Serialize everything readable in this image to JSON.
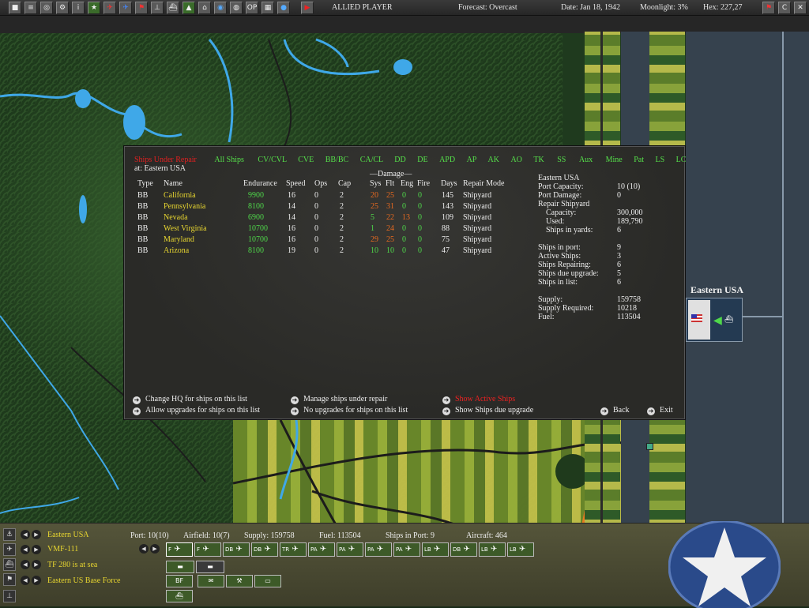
{
  "topbar": {
    "player": "ALLIED PLAYER",
    "forecast": "Forecast: Overcast",
    "date": "Date: Jan 18, 1942",
    "moonlight": "Moonlight: 3%",
    "hex": "Hex: 227,27",
    "icons": [
      "map-icon",
      "report-icon",
      "globe-icon",
      "settings-icon",
      "info-icon",
      "star-icon",
      "aircraft-icon",
      "plane-icon",
      "flag-icon",
      "unit-icon",
      "ship-icon",
      "base-icon",
      "factory-icon",
      "route-icon",
      "sphere-icon",
      "op-icon",
      "grid-icon",
      "help-icon",
      "end-turn-icon"
    ],
    "right_icons": [
      "flag-icon",
      "c-icon",
      "close-icon"
    ]
  },
  "map": {
    "location_label": "Eastern USA"
  },
  "dialog": {
    "categories": [
      "Ships Under Repair",
      "All Ships",
      "CV/CVL",
      "CVE",
      "BB/BC",
      "CA/CL",
      "DD",
      "DE",
      "APD",
      "AP",
      "AK",
      "AO",
      "TK",
      "SS",
      "Aux",
      "Mine",
      "Pat",
      "LS",
      "LC"
    ],
    "location": "at: Eastern USA",
    "damage_header": "—Damage—",
    "columns": [
      "Type",
      "Name",
      "Endurance",
      "Speed",
      "Ops",
      "Cap",
      "Sys",
      "Flt",
      "Eng",
      "Fire",
      "Days",
      "Repair Mode"
    ],
    "ships": [
      {
        "type": "BB",
        "name": "California",
        "endurance": "9900",
        "speed": "16",
        "ops": "0",
        "cap": "2",
        "sys": "20",
        "flt": "25",
        "eng": "0",
        "fire": "0",
        "days": "145",
        "mode": "Shipyard",
        "sys_color": "orange",
        "flt_color": "orange"
      },
      {
        "type": "BB",
        "name": "Pennsylvania",
        "endurance": "8100",
        "speed": "14",
        "ops": "0",
        "cap": "2",
        "sys": "25",
        "flt": "31",
        "eng": "0",
        "fire": "0",
        "days": "143",
        "mode": "Shipyard",
        "sys_color": "orange",
        "flt_color": "orange"
      },
      {
        "type": "BB",
        "name": "Nevada",
        "endurance": "6900",
        "speed": "14",
        "ops": "0",
        "cap": "2",
        "sys": "5",
        "flt": "22",
        "eng": "13",
        "fire": "0",
        "days": "109",
        "mode": "Shipyard",
        "sys_color": "green",
        "flt_color": "orange"
      },
      {
        "type": "BB",
        "name": "West Virginia",
        "endurance": "10700",
        "speed": "16",
        "ops": "0",
        "cap": "2",
        "sys": "1",
        "flt": "24",
        "eng": "0",
        "fire": "0",
        "days": "88",
        "mode": "Shipyard",
        "sys_color": "green",
        "flt_color": "orange"
      },
      {
        "type": "BB",
        "name": "Maryland",
        "endurance": "10700",
        "speed": "16",
        "ops": "0",
        "cap": "2",
        "sys": "29",
        "flt": "25",
        "eng": "0",
        "fire": "0",
        "days": "75",
        "mode": "Shipyard",
        "sys_color": "orange",
        "flt_color": "orange"
      },
      {
        "type": "BB",
        "name": "Arizona",
        "endurance": "8100",
        "speed": "19",
        "ops": "0",
        "cap": "2",
        "sys": "10",
        "flt": "10",
        "eng": "0",
        "fire": "0",
        "days": "47",
        "mode": "Shipyard",
        "sys_color": "green",
        "flt_color": "green"
      }
    ],
    "port_info": [
      {
        "label": "Eastern USA",
        "value": ""
      },
      {
        "label": "Port Capacity:",
        "value": "10 (10)"
      },
      {
        "label": "Port Damage:",
        "value": "0"
      },
      {
        "label": "Repair Shipyard",
        "value": ""
      },
      {
        "label": "Capacity:",
        "value": "300,000"
      },
      {
        "label": "Used:",
        "value": "189,790"
      },
      {
        "label": "Ships in yards:",
        "value": "6"
      },
      {
        "label": "",
        "value": ""
      },
      {
        "label": "Ships in port:",
        "value": "9"
      },
      {
        "label": "Active Ships:",
        "value": "3"
      },
      {
        "label": "Ships Repairing:",
        "value": "6"
      },
      {
        "label": "Ships due upgrade:",
        "value": "5"
      },
      {
        "label": "Ships in list:",
        "value": "6"
      },
      {
        "label": "",
        "value": ""
      },
      {
        "label": "Supply:",
        "value": "159758"
      },
      {
        "label": "Supply Required:",
        "value": "10218"
      },
      {
        "label": "Fuel:",
        "value": "113504"
      }
    ],
    "options": {
      "change_hq": "Change HQ for ships on this list",
      "allow_upgrades": "Allow upgrades for ships on this list",
      "manage_ships": "Manage ships under repair",
      "no_upgrades": "No upgrades for ships on this list",
      "show_active": "Show Active Ships",
      "show_due_upgrade": "Show Ships due upgrade",
      "back": "Back",
      "exit": "Exit"
    }
  },
  "bottom": {
    "base": "Eastern USA",
    "air_group": "VMF-111",
    "task_force": "TF 280 is at sea",
    "ground_force": "Eastern US Base Force",
    "port": "Port: 10(10)",
    "airfield": "Airfield: 10(7)",
    "supply": "Supply: 159758",
    "fuel": "Fuel: 113504",
    "ships_in_port": "Ships in Port: 9",
    "aircraft": "Aircraft: 464",
    "air_types": [
      "F",
      "F",
      "DB",
      "DB",
      "TR",
      "PA",
      "PA",
      "PA",
      "PA",
      "LB",
      "DB",
      "LB",
      "LB"
    ],
    "base_button": "BF"
  }
}
